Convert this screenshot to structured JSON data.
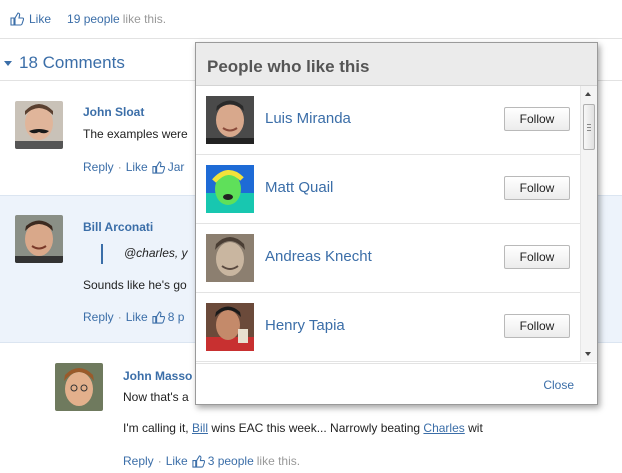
{
  "likebar": {
    "like_label": "Like",
    "people_count": "19 people",
    "like_suffix": "like this."
  },
  "comments": {
    "header": "18 Comments",
    "items": [
      {
        "author": "John Sloat",
        "text": "The examples were",
        "actions": {
          "reply": "Reply",
          "like": "Like",
          "like_tail": "Jar"
        }
      },
      {
        "author": "Bill Arconati",
        "quote": "@charles, y",
        "text": "Sounds like he's go",
        "actions": {
          "reply": "Reply",
          "like": "Like",
          "like_tail": "8 p"
        }
      },
      {
        "author": "John Masso",
        "text": "Now that's a",
        "text2_prefix": "I'm calling it, ",
        "text2_mention1": "Bill",
        "text2_middle": " wins EAC this week... Narrowly beating ",
        "text2_mention2": "Charles",
        "text2_suffix": " wit",
        "actions": {
          "reply": "Reply",
          "like": "Like",
          "people": "3 people",
          "like_suffix": "like this."
        }
      }
    ]
  },
  "popup": {
    "title": "People who like this",
    "people": [
      {
        "name": "Luis Miranda",
        "follow": "Follow"
      },
      {
        "name": "Matt Quail",
        "follow": "Follow"
      },
      {
        "name": "Andreas Knecht",
        "follow": "Follow"
      },
      {
        "name": "Henry Tapia",
        "follow": "Follow"
      }
    ],
    "close": "Close"
  },
  "colors": {
    "link": "#3b6ea8",
    "highlight_bg": "#edf3fb",
    "popup_head_bg": "#ebebeb"
  }
}
